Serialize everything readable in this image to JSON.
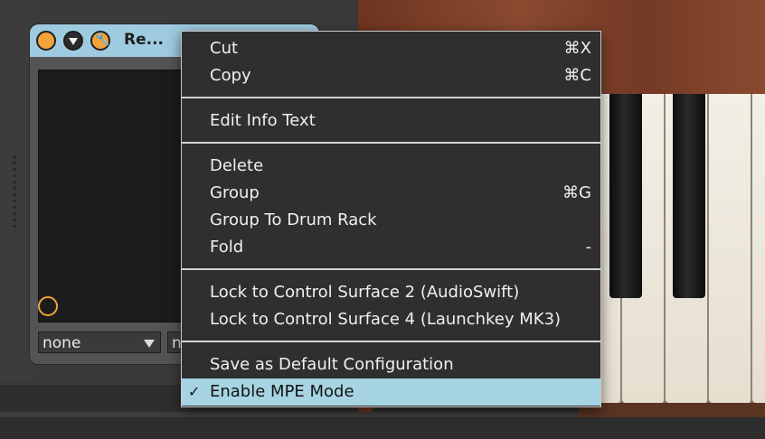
{
  "device": {
    "name": "Re...",
    "select_one": "none",
    "select_two": "n"
  },
  "menu": {
    "groups": [
      [
        {
          "label": "Cut",
          "shortcut": "⌘X"
        },
        {
          "label": "Copy",
          "shortcut": "⌘C"
        }
      ],
      [
        {
          "label": "Edit Info Text",
          "shortcut": ""
        }
      ],
      [
        {
          "label": "Delete",
          "shortcut": ""
        },
        {
          "label": "Group",
          "shortcut": "⌘G"
        },
        {
          "label": "Group To Drum Rack",
          "shortcut": ""
        },
        {
          "label": "Fold",
          "shortcut": "-"
        }
      ],
      [
        {
          "label": "Lock to Control Surface 2 (AudioSwift)",
          "shortcut": ""
        },
        {
          "label": "Lock to Control Surface 4 (Launchkey MK3)",
          "shortcut": ""
        }
      ],
      [
        {
          "label": "Save as Default Configuration",
          "shortcut": ""
        },
        {
          "label": "Enable MPE Mode",
          "shortcut": "",
          "checked": true,
          "highlighted": true
        }
      ]
    ],
    "check_glyph": "✓"
  },
  "colors": {
    "accent": "#a6d4e2",
    "device_title": "#9fcbe0",
    "orange": "#f2a33a"
  }
}
